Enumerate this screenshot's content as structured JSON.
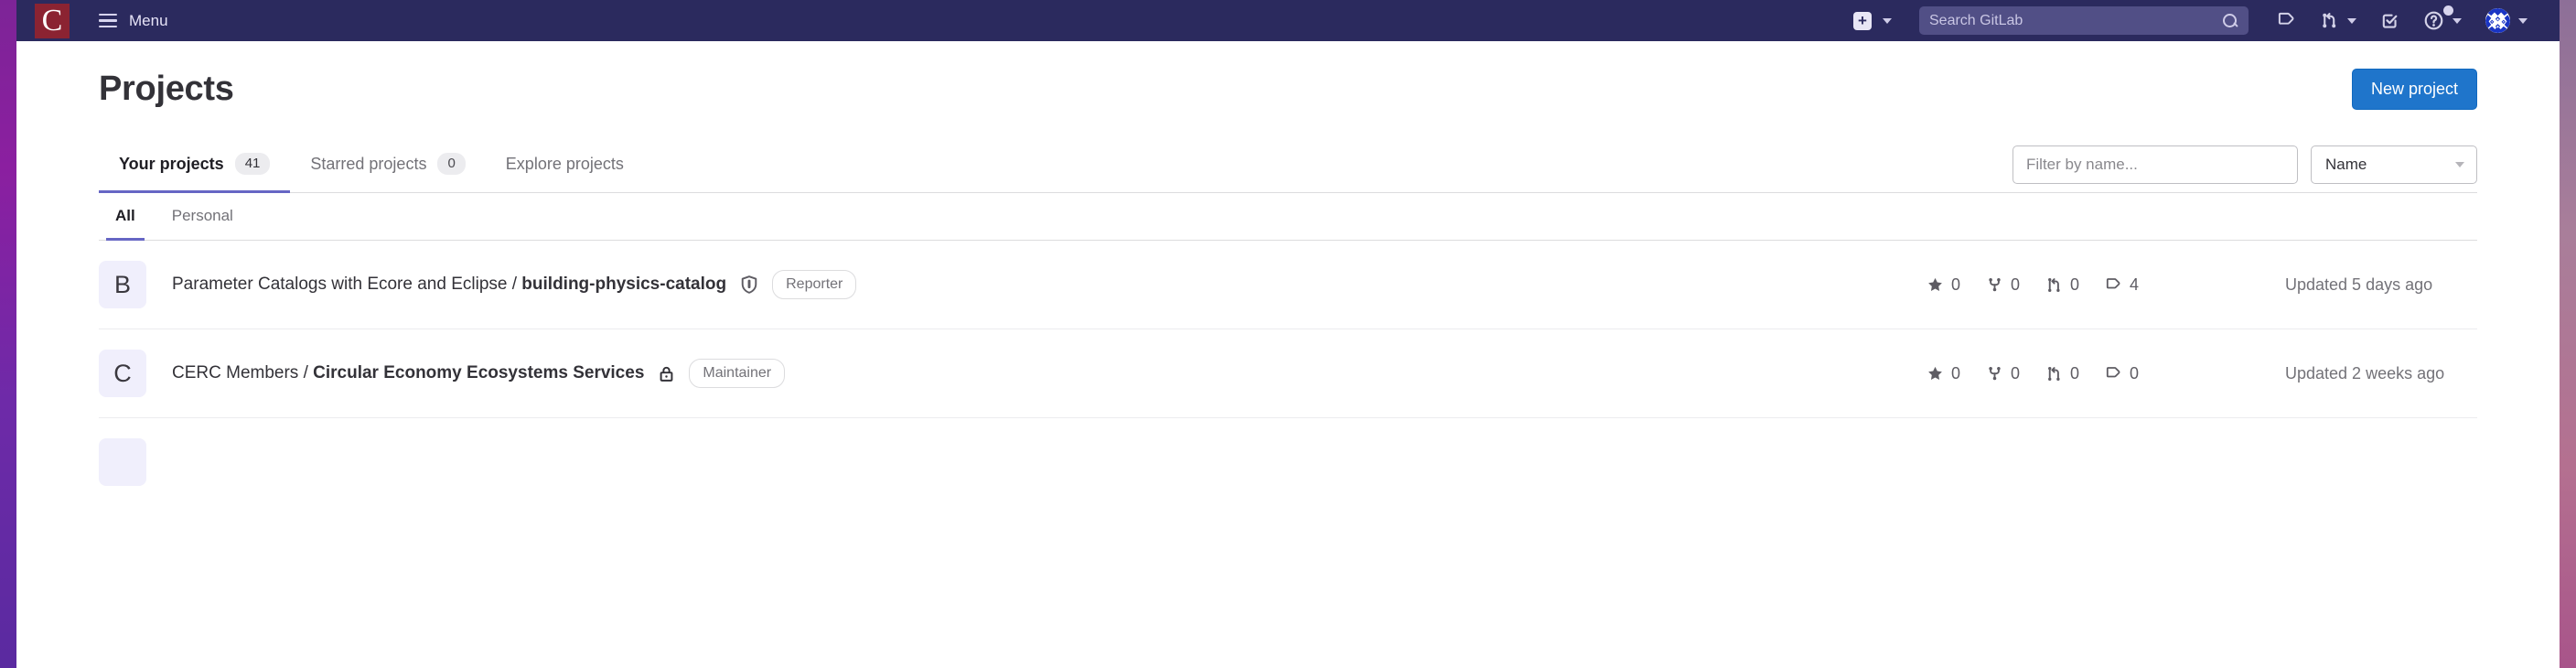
{
  "navbar": {
    "logo_letter": "C",
    "menu_label": "Menu",
    "create_new_icon": "plus-square-icon",
    "search": {
      "placeholder": "Search GitLab",
      "icon": "search-icon"
    },
    "icons": [
      {
        "name": "issues-icon",
        "label": "Issues"
      },
      {
        "name": "merge-requests-icon",
        "label": "Merge requests"
      },
      {
        "name": "todos-icon",
        "label": "To-Do List"
      },
      {
        "name": "help-icon",
        "label": "Help",
        "has_notification_dot": true
      },
      {
        "name": "user-avatar-identicon",
        "label": "User menu"
      }
    ],
    "colors": {
      "background": "#2b2a5e",
      "search_bg": "#514f86",
      "logo_bg": "#8b2332"
    }
  },
  "header": {
    "title": "Projects",
    "new_project_label": "New project",
    "new_project_color": "#1f75cb"
  },
  "tabs": [
    {
      "label": "Your projects",
      "count": "41",
      "active": true
    },
    {
      "label": "Starred projects",
      "count": "0",
      "active": false
    },
    {
      "label": "Explore projects",
      "count": "",
      "active": false
    }
  ],
  "filters": {
    "name_filter_placeholder": "Filter by name...",
    "name_filter_value": "",
    "sort_label": "Name",
    "sort_icon": "chevron-down-icon"
  },
  "subtabs": [
    {
      "label": "All",
      "active": true
    },
    {
      "label": "Personal",
      "active": false
    }
  ],
  "projects": [
    {
      "avatar_letter": "B",
      "namespace": "Parameter Catalogs with Ecore and Eclipse / ",
      "name": "building-physics-catalog",
      "visibility": "internal",
      "visibility_icon": "shield-icon",
      "role": "Reporter",
      "stars": "0",
      "forks": "0",
      "merge_requests": "0",
      "issues": "4",
      "updated": "Updated 5 days ago"
    },
    {
      "avatar_letter": "C",
      "namespace": "CERC Members / ",
      "name": "Circular Economy Ecosystems Services",
      "visibility": "private",
      "visibility_icon": "lock-icon",
      "role": "Maintainer",
      "stars": "0",
      "forks": "0",
      "merge_requests": "0",
      "issues": "0",
      "updated": "Updated 2 weeks ago"
    }
  ]
}
